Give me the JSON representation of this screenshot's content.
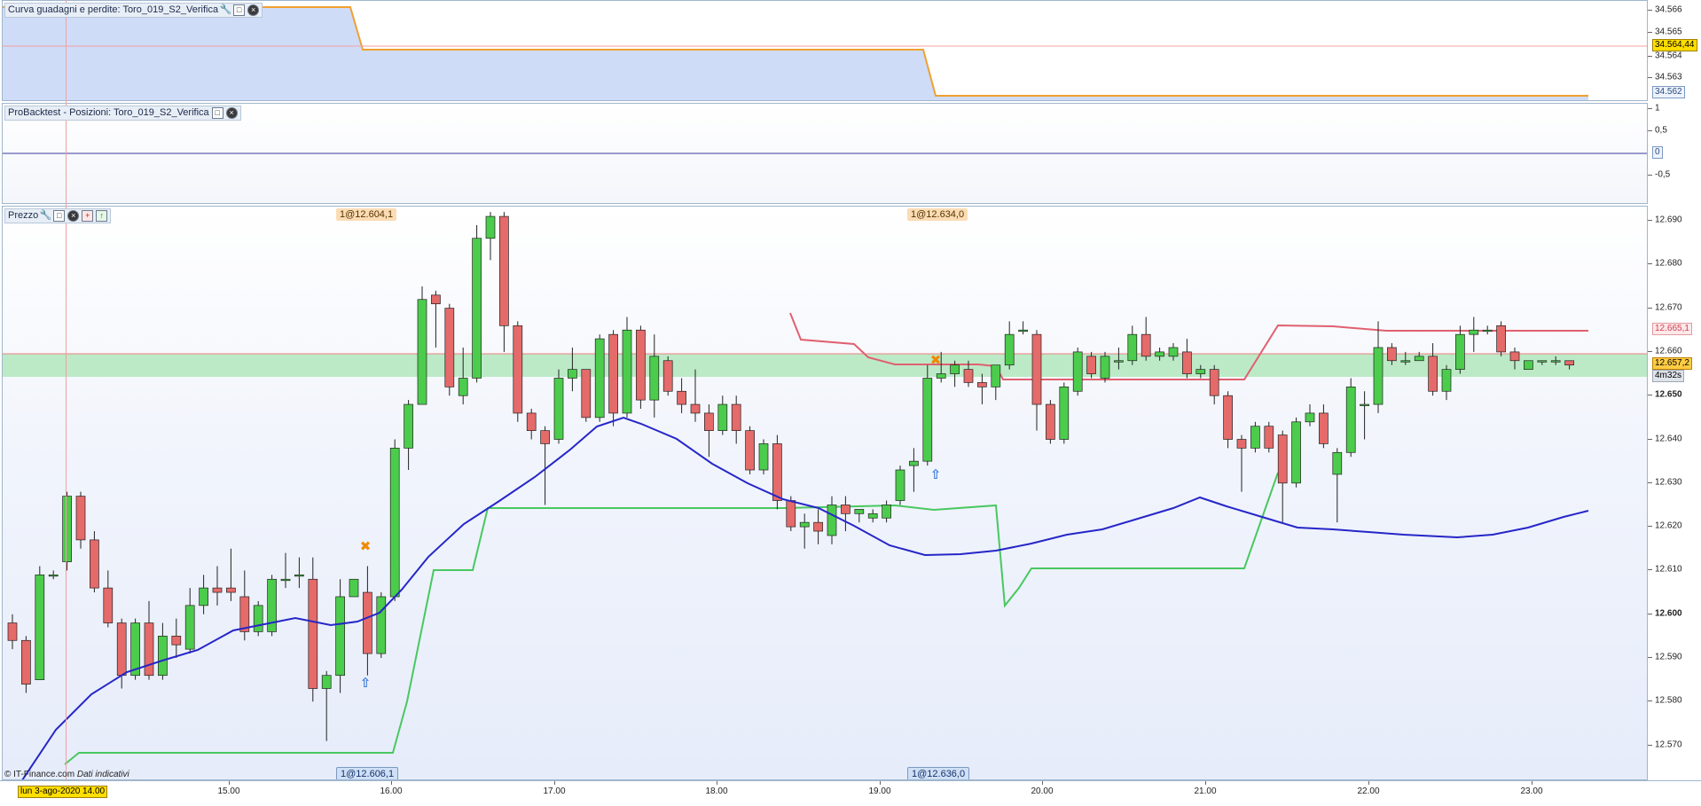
{
  "panel1": {
    "title": "Curva guadagni e perdite: Toro_019_S2_Verifica",
    "axis_ticks": [
      "34.566",
      "34.565",
      "34.564",
      "34.563"
    ],
    "tag_current": "34.564,44",
    "tag_low": "34.562",
    "line_color": "#f0a030",
    "fill_color": "#cfdcf8"
  },
  "panel2": {
    "title": "ProBacktest - Posizioni: Toro_019_S2_Verifica",
    "axis_ticks": [
      "1",
      "0,5",
      "-0,5"
    ],
    "tag_zero": "0"
  },
  "panel3": {
    "title": "Prezzo",
    "axis_ticks": [
      "12.690",
      "12.680",
      "12.670",
      "12.660",
      "12.650",
      "12.640",
      "12.630",
      "12.620",
      "12.610",
      "12.600",
      "12.590",
      "12.580",
      "12.570"
    ],
    "bold_ticks": [
      "12.650",
      "12.600"
    ],
    "tag_upper": "12.665,1",
    "tag_price": "12.657,2",
    "tag_timer": "4m32s",
    "order_labels": {
      "top_left": "1@12.604,1",
      "top_right": "1@12.634,0",
      "bottom_left": "1@12.606,1",
      "bottom_right": "1@12.636,0"
    },
    "colors": {
      "up": "#4ccc4c",
      "down": "#e56a6a",
      "ma": "#2626c8",
      "band_upper": "#e06070",
      "band_lower": "#48c860",
      "zone": "#a8e6b4"
    }
  },
  "xaxis": {
    "labels": [
      "15.00",
      "16.00",
      "17.00",
      "18.00",
      "19.00",
      "20.00",
      "21.00",
      "22.00",
      "23.00"
    ],
    "date_tag": "lun 3-ago-2020 14.00"
  },
  "copyright": {
    "source": "© IT-Finance.com",
    "note": "Dati indicativi"
  },
  "chart_data": {
    "type": "candlestick",
    "ylim": [
      12.566,
      12.692
    ],
    "candles": [
      [
        12.598,
        12.594,
        12.6,
        12.592
      ],
      [
        12.594,
        12.584,
        12.595,
        12.582
      ],
      [
        12.585,
        12.609,
        12.611,
        12.585
      ],
      [
        12.609,
        12.609,
        12.61,
        12.608
      ],
      [
        12.612,
        12.627,
        12.628,
        12.61
      ],
      [
        12.627,
        12.617,
        12.628,
        12.615
      ],
      [
        12.617,
        12.606,
        12.619,
        12.605
      ],
      [
        12.606,
        12.598,
        12.61,
        12.597
      ],
      [
        12.598,
        12.586,
        12.599,
        12.583
      ],
      [
        12.586,
        12.598,
        12.599,
        12.585
      ],
      [
        12.598,
        12.586,
        12.603,
        12.585
      ],
      [
        12.586,
        12.595,
        12.598,
        12.585
      ],
      [
        12.595,
        12.593,
        12.599,
        12.59
      ],
      [
        12.592,
        12.602,
        12.606,
        12.591
      ],
      [
        12.602,
        12.606,
        12.609,
        12.6
      ],
      [
        12.606,
        12.605,
        12.611,
        12.602
      ],
      [
        12.606,
        12.605,
        12.615,
        12.603
      ],
      [
        12.604,
        12.596,
        12.61,
        12.594
      ],
      [
        12.596,
        12.602,
        12.603,
        12.595
      ],
      [
        12.596,
        12.608,
        12.609,
        12.595
      ],
      [
        12.608,
        12.608,
        12.614,
        12.606
      ],
      [
        12.609,
        12.609,
        12.613,
        12.606
      ],
      [
        12.608,
        12.583,
        12.613,
        12.58
      ],
      [
        12.583,
        12.586,
        12.587,
        12.571
      ],
      [
        12.586,
        12.604,
        12.608,
        12.582
      ],
      [
        12.604,
        12.608,
        12.608,
        12.604
      ],
      [
        12.605,
        12.591,
        12.611,
        12.586
      ],
      [
        12.591,
        12.604,
        12.605,
        12.59
      ],
      [
        12.604,
        12.638,
        12.64,
        12.603
      ],
      [
        12.638,
        12.648,
        12.649,
        12.633
      ],
      [
        12.648,
        12.672,
        12.675,
        12.648
      ],
      [
        12.673,
        12.671,
        12.674,
        12.661
      ],
      [
        12.67,
        12.652,
        12.671,
        12.65
      ],
      [
        12.65,
        12.654,
        12.661,
        12.648
      ],
      [
        12.654,
        12.686,
        12.689,
        12.653
      ],
      [
        12.686,
        12.691,
        12.692,
        12.681
      ],
      [
        12.691,
        12.666,
        12.692,
        12.66
      ],
      [
        12.666,
        12.646,
        12.667,
        12.644
      ],
      [
        12.646,
        12.642,
        12.647,
        12.64
      ],
      [
        12.642,
        12.639,
        12.643,
        12.625
      ],
      [
        12.64,
        12.654,
        12.656,
        12.639
      ],
      [
        12.654,
        12.656,
        12.661,
        12.651
      ],
      [
        12.656,
        12.645,
        12.656,
        12.644
      ],
      [
        12.645,
        12.663,
        12.664,
        12.644
      ],
      [
        12.664,
        12.646,
        12.665,
        12.643
      ],
      [
        12.646,
        12.665,
        12.668,
        12.645
      ],
      [
        12.665,
        12.649,
        12.666,
        12.647
      ],
      [
        12.649,
        12.659,
        12.664,
        12.645
      ],
      [
        12.658,
        12.651,
        12.659,
        12.65
      ],
      [
        12.651,
        12.648,
        12.654,
        12.646
      ],
      [
        12.648,
        12.646,
        12.656,
        12.644
      ],
      [
        12.646,
        12.642,
        12.648,
        12.636
      ],
      [
        12.642,
        12.648,
        12.65,
        12.641
      ],
      [
        12.648,
        12.642,
        12.65,
        12.639
      ],
      [
        12.642,
        12.633,
        12.643,
        12.632
      ],
      [
        12.633,
        12.639,
        12.64,
        12.632
      ],
      [
        12.639,
        12.626,
        12.641,
        12.624
      ],
      [
        12.626,
        12.62,
        12.627,
        12.619
      ],
      [
        12.62,
        12.621,
        12.623,
        12.615
      ],
      [
        12.621,
        12.619,
        12.624,
        12.616
      ],
      [
        12.618,
        12.625,
        12.627,
        12.616
      ],
      [
        12.625,
        12.623,
        12.627,
        12.619
      ],
      [
        12.623,
        12.624,
        12.624,
        12.621
      ],
      [
        12.622,
        12.623,
        12.624,
        12.621
      ],
      [
        12.622,
        12.625,
        12.626,
        12.621
      ],
      [
        12.626,
        12.633,
        12.634,
        12.625
      ],
      [
        12.634,
        12.635,
        12.638,
        12.628
      ],
      [
        12.635,
        12.654,
        12.657,
        12.634
      ],
      [
        12.654,
        12.655,
        12.66,
        12.653
      ],
      [
        12.655,
        12.657,
        12.658,
        12.652
      ],
      [
        12.656,
        12.653,
        12.658,
        12.652
      ],
      [
        12.653,
        12.652,
        12.655,
        12.648
      ],
      [
        12.652,
        12.657,
        12.657,
        12.649
      ],
      [
        12.657,
        12.664,
        12.667,
        12.656
      ],
      [
        12.665,
        12.665,
        12.667,
        12.664
      ],
      [
        12.664,
        12.648,
        12.665,
        12.642
      ],
      [
        12.648,
        12.64,
        12.649,
        12.639
      ],
      [
        12.64,
        12.652,
        12.653,
        12.639
      ],
      [
        12.651,
        12.66,
        12.661,
        12.65
      ],
      [
        12.659,
        12.655,
        12.66,
        12.654
      ],
      [
        12.654,
        12.659,
        12.66,
        12.653
      ],
      [
        12.658,
        12.658,
        12.661,
        12.656
      ],
      [
        12.658,
        12.664,
        12.666,
        12.657
      ],
      [
        12.664,
        12.659,
        12.668,
        12.658
      ],
      [
        12.659,
        12.66,
        12.661,
        12.658
      ],
      [
        12.659,
        12.661,
        12.662,
        12.658
      ],
      [
        12.66,
        12.655,
        12.663,
        12.654
      ],
      [
        12.655,
        12.656,
        12.657,
        12.654
      ],
      [
        12.656,
        12.65,
        12.657,
        12.648
      ],
      [
        12.65,
        12.64,
        12.651,
        12.638
      ],
      [
        12.64,
        12.638,
        12.641,
        12.628
      ],
      [
        12.638,
        12.643,
        12.644,
        12.637
      ],
      [
        12.643,
        12.638,
        12.644,
        12.637
      ],
      [
        12.641,
        12.63,
        12.642,
        12.621
      ],
      [
        12.63,
        12.644,
        12.645,
        12.629
      ],
      [
        12.644,
        12.646,
        12.648,
        12.643
      ],
      [
        12.646,
        12.639,
        12.648,
        12.638
      ],
      [
        12.632,
        12.637,
        12.638,
        12.621
      ],
      [
        12.637,
        12.652,
        12.654,
        12.636
      ],
      [
        12.648,
        12.648,
        12.651,
        12.64
      ],
      [
        12.648,
        12.661,
        12.667,
        12.646
      ],
      [
        12.661,
        12.658,
        12.662,
        12.657
      ],
      [
        12.658,
        12.658,
        12.66,
        12.657
      ],
      [
        12.658,
        12.659,
        12.66,
        12.658
      ],
      [
        12.659,
        12.651,
        12.662,
        12.65
      ],
      [
        12.651,
        12.656,
        12.657,
        12.649
      ],
      [
        12.656,
        12.664,
        12.666,
        12.655
      ],
      [
        12.664,
        12.665,
        12.668,
        12.66
      ],
      [
        12.665,
        12.665,
        12.666,
        12.664
      ],
      [
        12.666,
        12.66,
        12.667,
        12.659
      ],
      [
        12.66,
        12.658,
        12.661,
        12.656
      ],
      [
        12.656,
        12.658,
        12.658,
        12.656
      ],
      [
        12.658,
        12.658,
        12.658,
        12.657
      ],
      [
        12.658,
        12.658,
        12.659,
        12.657
      ],
      [
        12.658,
        12.657,
        12.658,
        12.656
      ]
    ]
  }
}
